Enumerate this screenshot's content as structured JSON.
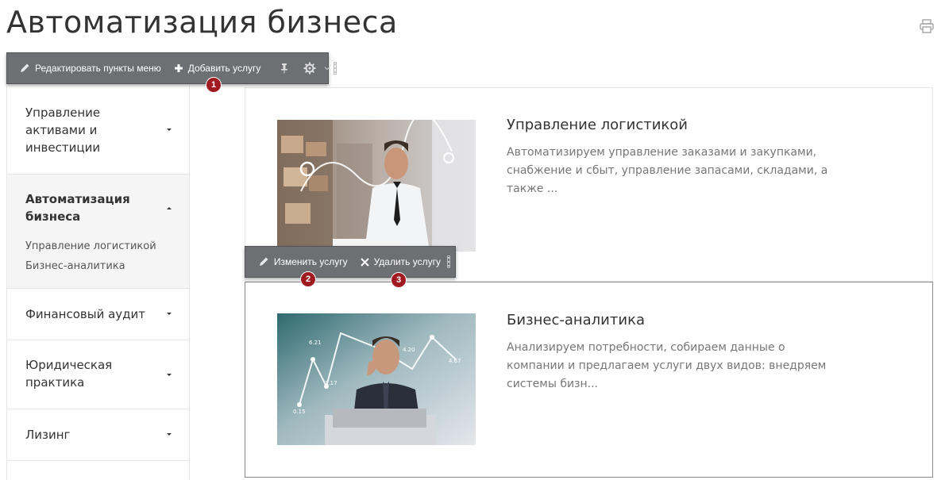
{
  "page": {
    "title": "Автоматизация бизнеса"
  },
  "toolbar_top": {
    "edit_menu_label": "Редактировать пункты меню",
    "add_service_label": "Добавить услугу",
    "badge": "1"
  },
  "toolbar_item": {
    "edit_label": "Изменить услугу",
    "delete_label": "Удалить услугу",
    "badge_edit": "2",
    "badge_delete": "3"
  },
  "sidebar": {
    "items": [
      {
        "label": "Управление активами и инвестиции"
      },
      {
        "label": "Автоматизация бизнеса",
        "sub": [
          "Управление логистикой",
          "Бизнес-аналитика"
        ]
      },
      {
        "label": "Финансовый аудит"
      },
      {
        "label": "Юридическая практика"
      },
      {
        "label": "Лизинг"
      }
    ]
  },
  "services": [
    {
      "title": "Управление логистикой",
      "description": "Автоматизируем управление заказами и закупками, снабжение и сбыт, управление запасами, складами, а также ..."
    },
    {
      "title": "Бизнес-аналитика",
      "description": "Анализируем потребности, собираем данные о компании и предлагаем услуги двух видов: внедряем системы бизн...",
      "chart_labels": [
        "6.21",
        "3.17",
        "0.15",
        "4.67",
        "4.20"
      ]
    }
  ],
  "colors": {
    "toolbar_bg": "#6e6f73",
    "badge": "#a11921",
    "active_border": "#888888"
  }
}
